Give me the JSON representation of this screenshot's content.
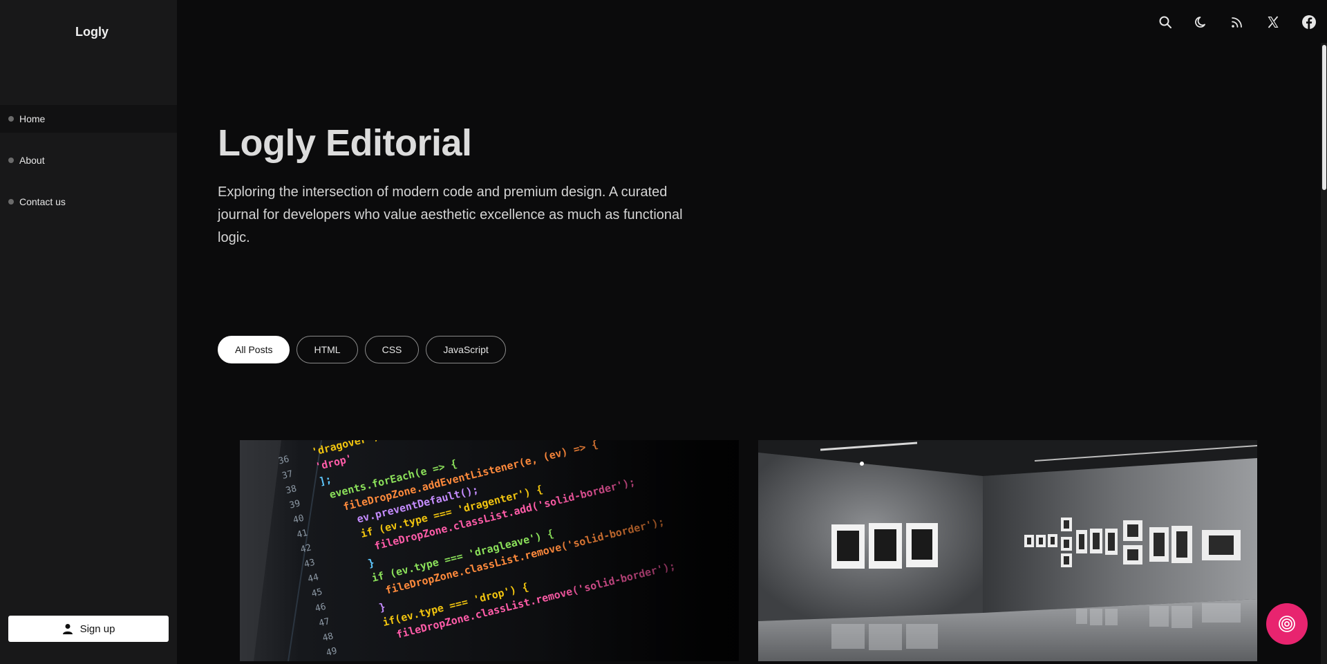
{
  "sidebar": {
    "brand": "Logly",
    "items": [
      {
        "label": "Home",
        "active": true
      },
      {
        "label": "About",
        "active": false
      },
      {
        "label": "Contact us",
        "active": false
      }
    ],
    "signup_label": "Sign up",
    "signup_icon": "user-icon"
  },
  "topbar": {
    "icons": [
      "search-icon",
      "moon-icon",
      "rss-icon",
      "x-twitter-icon",
      "facebook-icon"
    ]
  },
  "hero": {
    "title": "Logly Editorial",
    "description": "Exploring the intersection of modern code and premium design. A curated journal for developers who value aesthetic excellence as much as functional logic."
  },
  "filters": {
    "all": "All Posts",
    "html": "HTML",
    "css": "CSS",
    "javascript": "JavaScript",
    "active": "All Posts"
  },
  "cards": {
    "code": {
      "line_numbers": [
        "36",
        "37",
        "38",
        "39",
        "40",
        "41",
        "42",
        "43",
        "44",
        "45",
        "46",
        "47",
        "48",
        "49"
      ],
      "lines": [
        "'dragover',",
        "'drop'",
        "];",
        "events.forEach(e => {",
        "fileDropZone.addEventListener(e, (ev) => {",
        "ev.preventDefault();",
        "if (ev.type === 'dragenter') {",
        "fileDropZone.classList.add('solid-border');",
        "}",
        "if (ev.type === 'dragleave') {",
        "fileDropZone.classList.remove('solid-border');",
        "}",
        "if(ev.type === 'drop') {",
        "fileDropZone.classList.remove('solid-border');"
      ]
    }
  },
  "fab": {
    "icon": "target-icon"
  },
  "colors": {
    "background": "#0b0b0c",
    "sidebar": "#181819",
    "accent": "#e8246f"
  }
}
